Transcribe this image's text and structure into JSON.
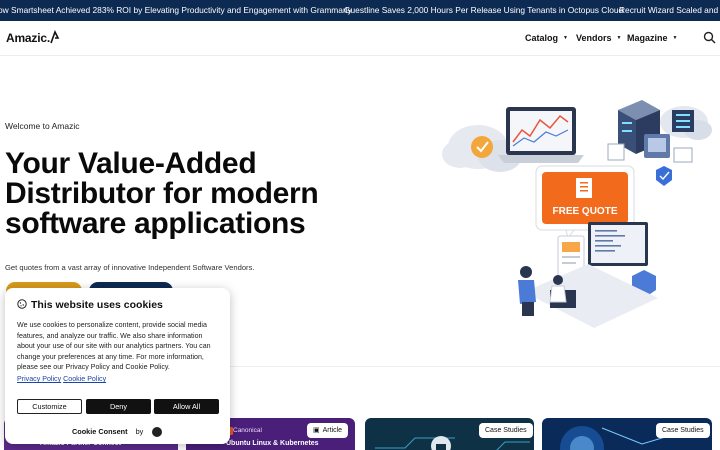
{
  "ticker": {
    "items": [
      "ow Smartsheet Achieved 283% ROI by Elevating Productivity and Engagement with Grammarly",
      "Guestline Saves 2,000 Hours Per Release Using Tenants in Octopus Cloud",
      "Recruit Wizard Scaled and Mo"
    ]
  },
  "header": {
    "logo": "Amazic.",
    "nav": [
      "Catalog",
      "Vendors",
      "Magazine"
    ]
  },
  "hero": {
    "eyebrow": "Welcome to Amazic",
    "title": "Your Value-Added Distributor for modern software applications",
    "subtitle": "Get quotes from a vast array of innovative Independent Software Vendors.",
    "illustration_label": "FREE QUOTE"
  },
  "cards": [
    {
      "text": "Amazic Partner Connect"
    },
    {
      "badge": "Article",
      "brand": "Canonical",
      "text": "Ubuntu Linux & Kubernetes"
    },
    {
      "badge": "Case Studies"
    },
    {
      "badge": "Case Studies"
    }
  ],
  "cookie": {
    "title": "This website uses cookies",
    "body": "We use cookies to personalize content, provide social media features, and analyze our traffic. We also share information about your use of our site with our analytics partners. You can change your preferences at any time. For more information, please see our Privacy Policy and Cookie Policy.",
    "link_privacy": "Privacy Policy",
    "link_cookie": "Cookie Policy",
    "btn_customize": "Customize",
    "btn_deny": "Deny",
    "btn_allow": "Allow All",
    "consent_label": "Cookie Consent",
    "consent_by": "by"
  },
  "colors": {
    "ticker_bg": "#0d2a52",
    "accent_orange": "#f26a1b",
    "cta_gold": "#d79a1c",
    "navy": "#0d2a52"
  }
}
